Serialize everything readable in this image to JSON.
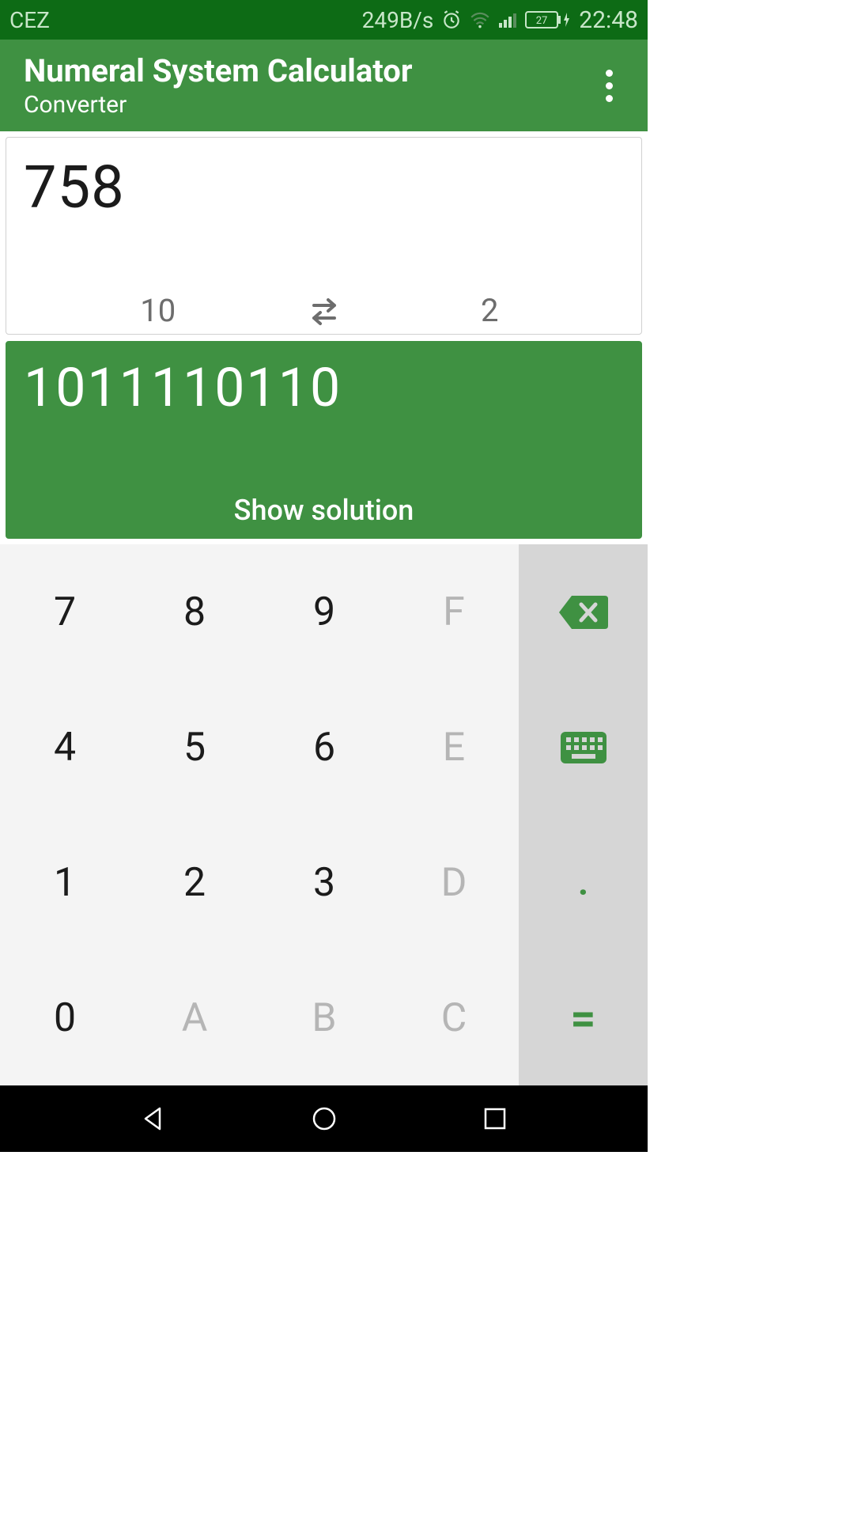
{
  "status": {
    "carrier": "CEZ",
    "speed": "249B/s",
    "battery": "27",
    "time": "22:48"
  },
  "app": {
    "title": "Numeral System Calculator",
    "subtitle": "Converter"
  },
  "input": {
    "value": "758",
    "from_base": "10",
    "to_base": "2"
  },
  "output": {
    "value": "1011110110",
    "solution_label": "Show solution"
  },
  "keys": {
    "r0c0": "7",
    "r0c1": "8",
    "r0c2": "9",
    "r0c3": "F",
    "r1c0": "4",
    "r1c1": "5",
    "r1c2": "6",
    "r1c3": "E",
    "r2c0": "1",
    "r2c1": "2",
    "r2c2": "3",
    "r2c3": "D",
    "r3c0": "0",
    "r3c1": "A",
    "r3c2": "B",
    "r3c3": "C",
    "side2": ".",
    "side3": "="
  }
}
